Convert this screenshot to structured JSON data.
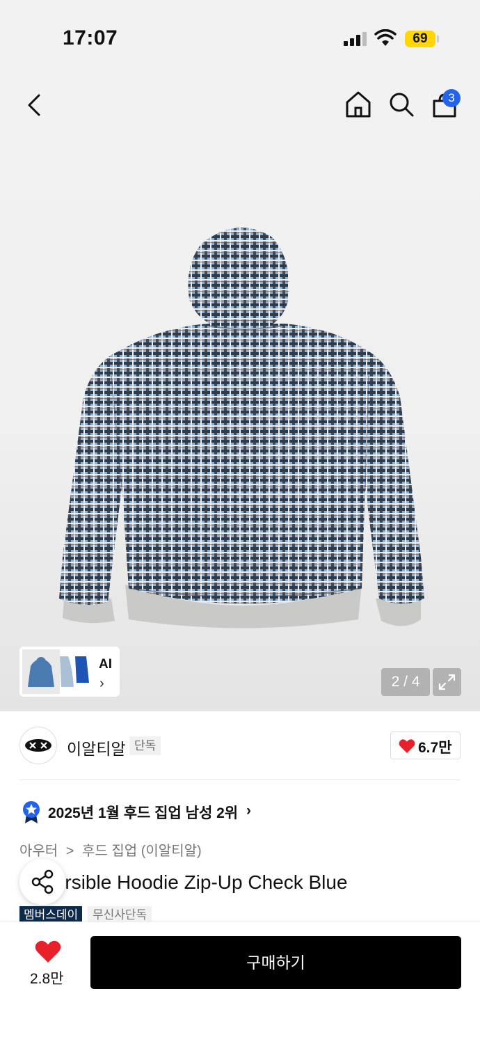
{
  "status_bar": {
    "time": "17:07",
    "battery": "69"
  },
  "nav": {
    "back_icon": "chevron-left-icon",
    "home_icon": "home-icon",
    "search_icon": "search-icon",
    "cart_icon": "shopping-bag-icon",
    "cart_count": "3"
  },
  "gallery": {
    "ai_label": "AI",
    "page_indicator": "2 / 4",
    "current_page": 2,
    "total_pages": 4
  },
  "brand": {
    "name": "이알티알",
    "exclusive_tag": "단독",
    "likes": "6.7만"
  },
  "ranking": {
    "text": "2025년 1월 후드 집업 남성 2위"
  },
  "breadcrumb": {
    "category": "아우터",
    "separator": ">",
    "subcategory": "후드 집업 (이알티알)"
  },
  "product": {
    "title": "Reversible Hoodie Zip-Up Check Blue"
  },
  "tags": [
    "멤버스데이",
    "무신사단독"
  ],
  "bottom_bar": {
    "wish_count": "2.8만",
    "buy_label": "구매하기"
  },
  "colors": {
    "accent_blue": "#2463eb",
    "heart_red": "#e8202a",
    "badge_yellow": "#ffd60a",
    "tag_navy": "#0e2a4a"
  }
}
